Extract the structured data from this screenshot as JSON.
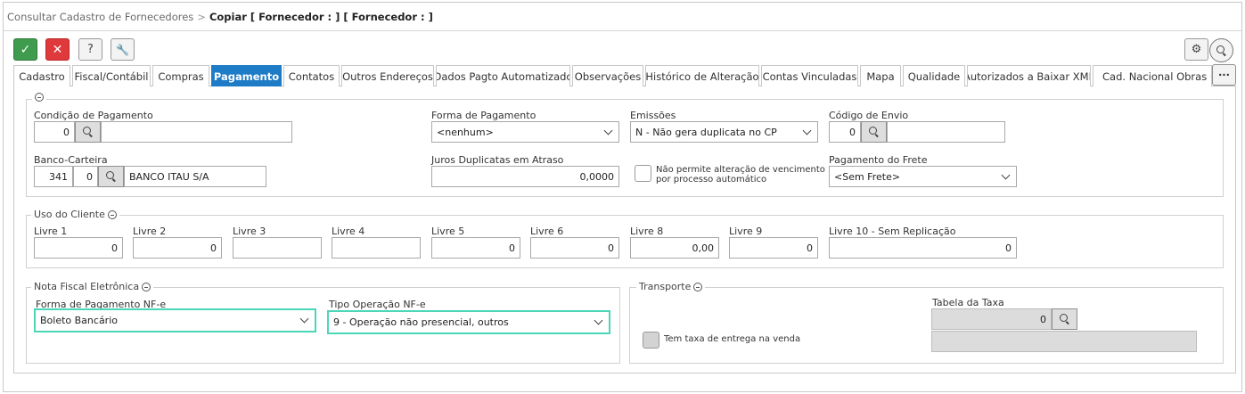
{
  "breadcrumb": {
    "parent": "Consultar Cadastro de Fornecedores",
    "separator": ">",
    "current": "Copiar [ Fornecedor : ] [ Fornecedor : ]"
  },
  "toolbar": {
    "confirm_icon": "✓",
    "cancel_icon": "✕",
    "help_icon": "?",
    "tools_icon": "🔧",
    "settings_icon": "⚙",
    "search_icon": "search-icon"
  },
  "tabs": [
    "Cadastro",
    "Fiscal/Contábil",
    "Compras",
    "Pagamento",
    "Contatos",
    "Outros Endereços",
    "Dados Pagto Automatizado",
    "Observações",
    "Histórico de Alteração",
    "Contas Vinculadas",
    "Mapa",
    "Qualidade",
    "Autorizados a Baixar XML",
    "Cad. Nacional Obras (CNO)"
  ],
  "active_tab": "Pagamento",
  "more_tabs": "···",
  "pagamento": {
    "condicao_label": "Condição de Pagamento",
    "condicao_value": "0",
    "condicao_desc": "",
    "forma_label": "Forma de Pagamento",
    "forma_value": "<nenhum>",
    "emissoes_label": "Emissões",
    "emissoes_value": "N - Não gera duplicata no CP",
    "codigo_envio_label": "Código de Envio",
    "codigo_envio_value": "0",
    "codigo_envio_desc": "",
    "banco_label": "Banco-Carteira",
    "banco_value": "341",
    "carteira_value": "0",
    "banco_desc": "BANCO ITAU S/A",
    "juros_label": "Juros Duplicatas em Atraso",
    "juros_value": "0,0000",
    "nao_permite_label_1": "Não permite alteração de vencimento",
    "nao_permite_label_2": "por processo automático",
    "frete_label": "Pagamento do Frete",
    "frete_value": "<Sem Frete>"
  },
  "uso_cliente": {
    "legend": "Uso do Cliente",
    "fields": [
      {
        "label": "Livre 1",
        "value": "0"
      },
      {
        "label": "Livre 2",
        "value": "0"
      },
      {
        "label": "Livre 3",
        "value": ""
      },
      {
        "label": "Livre 4",
        "value": ""
      },
      {
        "label": "Livre 5",
        "value": "0"
      },
      {
        "label": "Livre 6",
        "value": "0"
      },
      {
        "label": "Livre 8",
        "value": "0,00"
      },
      {
        "label": "Livre 9",
        "value": "0"
      },
      {
        "label": "Livre 10 - Sem Replicação",
        "value": "0"
      }
    ]
  },
  "nfe": {
    "legend": "Nota Fiscal Eletrônica",
    "forma_label": "Forma de Pagamento NF-e",
    "forma_value": "Boleto Bancário",
    "tipo_label": "Tipo Operação NF-e",
    "tipo_value": "9 - Operação não presencial, outros"
  },
  "transporte": {
    "legend": "Transporte",
    "tabela_label": "Tabela da Taxa",
    "tabela_value": "0",
    "tabela_desc": "",
    "tem_taxa_label": "Tem taxa de entrega na venda"
  },
  "colors": {
    "accent": "#1e7bc6",
    "ok": "#3f9b4d",
    "cancel": "#e0393b",
    "highlight": "#4bd6b8"
  }
}
